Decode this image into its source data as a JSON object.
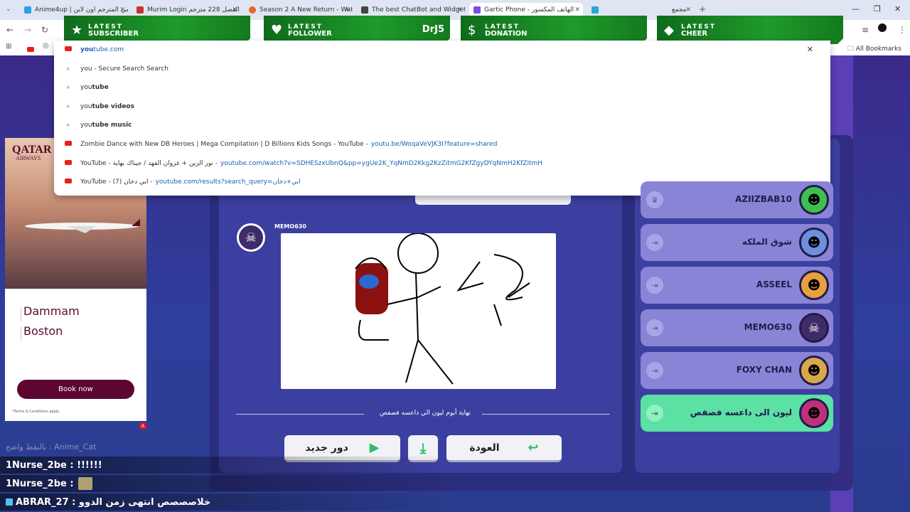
{
  "browser": {
    "tabs": [
      {
        "label": "Anime4up | أنمي المترجم اون لاين",
        "color": "#29a0e8"
      },
      {
        "label": "Murim Login الفصل 228 مترجم",
        "color": "#c6362c"
      },
      {
        "label": "Season 2 A New Return - Watch",
        "color": "#e8632b"
      },
      {
        "label": "The best ChatBot and Widgets",
        "color": "#444444"
      },
      {
        "label": "Gartic Phone - الهاتف المكسور",
        "color": "#7b4de0"
      },
      {
        "label": "مجمع",
        "color": "#2aa6d8"
      }
    ],
    "all_bookmarks": "All Bookmarks"
  },
  "alerts": [
    {
      "key": "LATEST",
      "value": "SUBSCRIBER",
      "icon": "★",
      "name": ""
    },
    {
      "key": "LATEST",
      "value": "FOLLOWER",
      "icon": "♥",
      "name": "DrJ5"
    },
    {
      "key": "LATEST",
      "value": "DONATION",
      "icon": "$",
      "name": ""
    },
    {
      "key": "LATEST",
      "value": "CHEER",
      "icon": "◆",
      "name": ""
    }
  ],
  "omnibox": {
    "rows": [
      {
        "type": "yt",
        "bold_prefix": "you",
        "text": "tube.com",
        "url": ""
      },
      {
        "type": "search",
        "bold_prefix": "",
        "text": "you - Secure Search Search",
        "url": ""
      },
      {
        "type": "search",
        "bold_prefix": "you",
        "text": "tube",
        "url": ""
      },
      {
        "type": "search",
        "bold_prefix": "you",
        "text": "tube videos",
        "url": ""
      },
      {
        "type": "search",
        "bold_prefix": "you",
        "text": "tube music",
        "url": ""
      },
      {
        "type": "yt",
        "bold_prefix": "",
        "text": "Zombie Dance with New DB Heroes | Mega Compilation | D Billions Kids Songs - YouTube -",
        "url": "youtu.be/WoqaVeVJK3I?feature=shared"
      },
      {
        "type": "yt",
        "bold_prefix": "",
        "text": "YouTube - نور الزين + غزوان الفهد / جيناك بهاية -",
        "url": "youtube.com/watch?v=SDHESzxUbnQ&pp=ygUe2K_YqNmD2Kkg2KzZitmG2KfZgyDYqNmH2KfZitmH"
      },
      {
        "type": "yt",
        "bold_prefix": "",
        "text": "YouTube - (7) ابي دخان -",
        "url": "youtube.com/results?search_query=ابي+دخان"
      }
    ]
  },
  "ad": {
    "brand": "QATAR",
    "brand_sub": "AIRWAYS",
    "city1": "Dammam",
    "city2": "Boston",
    "cta": "Book now",
    "terms": "*Terms & Conditions apply"
  },
  "game": {
    "author": "MEMO630",
    "caption": "نهاية أبوم ليون الي داعسه فصفص",
    "buttons": {
      "new_round": "دور جديد",
      "back": "العودة"
    },
    "players": [
      {
        "name": "AZIIZBAB10",
        "avatar_color": "#3fbf52"
      },
      {
        "name": "شوق الملكه",
        "avatar_color": "#6c8fe0"
      },
      {
        "name": "ASSEEL",
        "avatar_color": "#e8a040"
      },
      {
        "name": "MEMO630",
        "avatar_color": "#3f2b6a"
      },
      {
        "name": "FOXY CHAN",
        "avatar_color": "#d8a84a"
      },
      {
        "name": "ليون الى داعسه فصفص",
        "avatar_color": "#c0307a"
      }
    ]
  },
  "chat": [
    {
      "text": "بالنقط واضح : Anime_Cat",
      "faded": true
    },
    {
      "text": "1Nurse_2be : !!!!!!",
      "faded": false
    },
    {
      "text": "1Nurse_2be :",
      "faded": false,
      "emoji": true
    },
    {
      "text": "ABRAR_27 : خلاصصصص انتهى زمن الدوو",
      "faded": false,
      "hash": true
    }
  ]
}
